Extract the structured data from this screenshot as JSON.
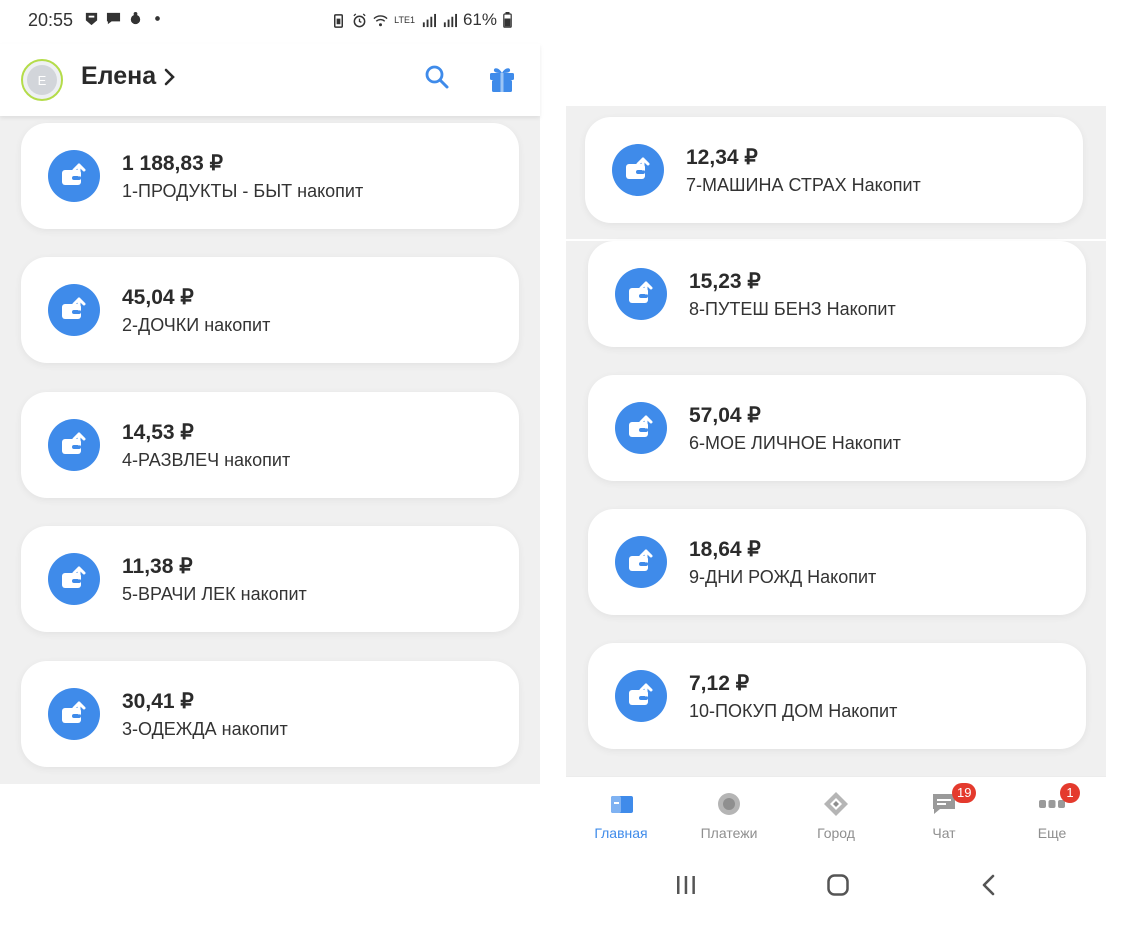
{
  "status": {
    "time": "20:55",
    "battery": "61%",
    "network": "LTE1",
    "carrier_icon": "Vo)"
  },
  "header": {
    "avatar_letter": "Е",
    "username": "Елена"
  },
  "left_accounts": [
    {
      "amount": "1 188,83 ₽",
      "name": "1-ПРОДУКТЫ - БЫТ накопит"
    },
    {
      "amount": "45,04 ₽",
      "name": "2-ДОЧКИ накопит"
    },
    {
      "amount": "14,53 ₽",
      "name": "4-РАЗВЛЕЧ накопит"
    },
    {
      "amount": "11,38 ₽",
      "name": "5-ВРАЧИ ЛЕК накопит"
    },
    {
      "amount": "30,41 ₽",
      "name": "3-ОДЕЖДА накопит"
    }
  ],
  "right_accounts": [
    {
      "amount": "12,34 ₽",
      "name": "7-МАШИНА СТРАХ Накопит"
    },
    {
      "amount": "15,23 ₽",
      "name": "8-ПУТЕШ БЕНЗ Накопит"
    },
    {
      "amount": "57,04 ₽",
      "name": "6-МОЕ ЛИЧНОЕ Накопит"
    },
    {
      "amount": "18,64 ₽",
      "name": "9-ДНИ РОЖД Накопит"
    },
    {
      "amount": "7,12 ₽",
      "name": "10-ПОКУП ДОМ Накопит"
    }
  ],
  "bottom_nav": [
    {
      "label": "Главная",
      "icon": "home-card-icon",
      "active": true,
      "badge": ""
    },
    {
      "label": "Платежи",
      "icon": "payments-circle-icon",
      "active": false,
      "badge": ""
    },
    {
      "label": "Город",
      "icon": "city-diamond-icon",
      "active": false,
      "badge": ""
    },
    {
      "label": "Чат",
      "icon": "chat-bubble-icon",
      "active": false,
      "badge": "19"
    },
    {
      "label": "Еще",
      "icon": "more-dots-icon",
      "active": false,
      "badge": "1"
    }
  ],
  "colors": {
    "accent": "#3f8bea",
    "badge": "#e43a2d",
    "avatar_ring": "#b4dc4a",
    "list_background": "#f0f0f0"
  }
}
